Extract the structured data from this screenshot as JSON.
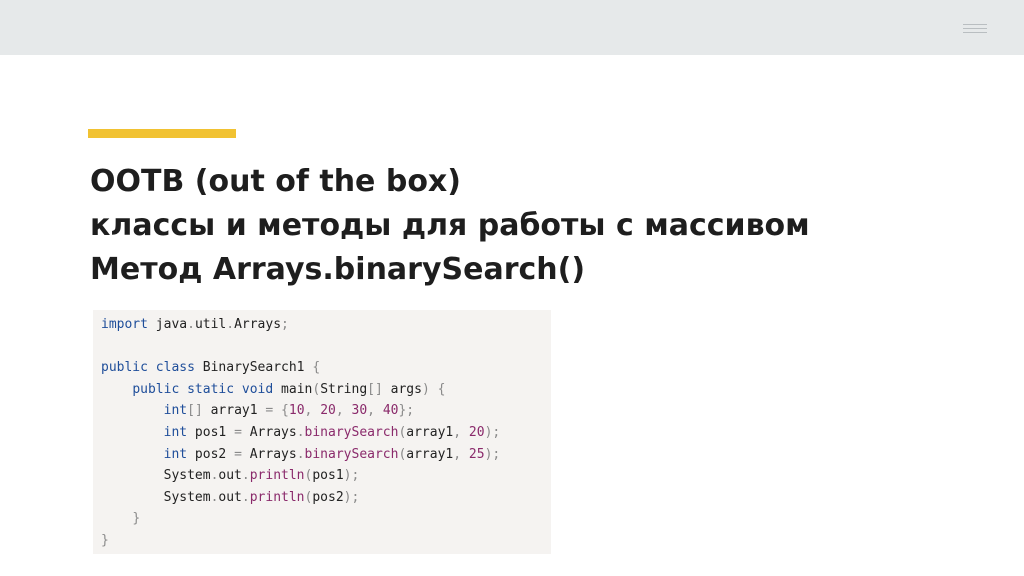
{
  "header": {
    "menu_icon": "hamburger-menu-icon"
  },
  "accent_color": "#f1c232",
  "title": {
    "line1": "OOTB (out of the box)",
    "line2": "классы и методы для работы с массивом",
    "line3": "Метод Arrays.binarySearch()"
  },
  "code": {
    "language": "java",
    "lines": [
      "import java.util.Arrays;",
      "",
      "public class BinarySearch1 {",
      "    public static void main(String[] args) {",
      "        int[] array1 = {10, 20, 30, 40};",
      "        int pos1 = Arrays.binarySearch(array1, 20);",
      "        int pos2 = Arrays.binarySearch(array1, 25);",
      "        System.out.println(pos1);",
      "        System.out.println(pos2);",
      "    }",
      "}"
    ]
  }
}
